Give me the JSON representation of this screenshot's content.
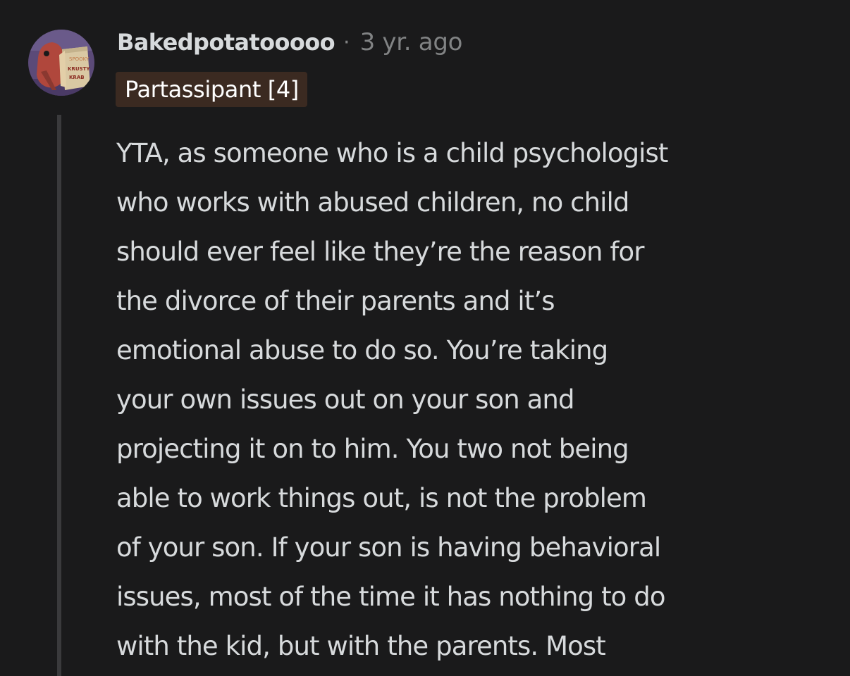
{
  "comment": {
    "author": "Bakedpotatooooo",
    "separator": "·",
    "timestamp": "3 yr. ago",
    "flair": "Partassipant [4]",
    "body_lines": [
      "YTA, as someone who is a child psychologist",
      "who works with abused children, no child",
      "should ever feel like they’re the reason for",
      "the divorce of their parents and it’s",
      "emotional abuse to do so. You’re taking",
      "your own issues out on your son and",
      "projecting it on to him. You two not being",
      "able to work things out, is not the problem",
      "of your son. If your son is having behavioral",
      "issues, most of the time it has nothing to do",
      "with the kid, but with the parents. Most"
    ],
    "avatar": {
      "icon": "krusty-krab-bag-avatar",
      "bag_text": [
        "SPOOKY",
        "KRUSTY",
        "KRAB"
      ]
    }
  }
}
